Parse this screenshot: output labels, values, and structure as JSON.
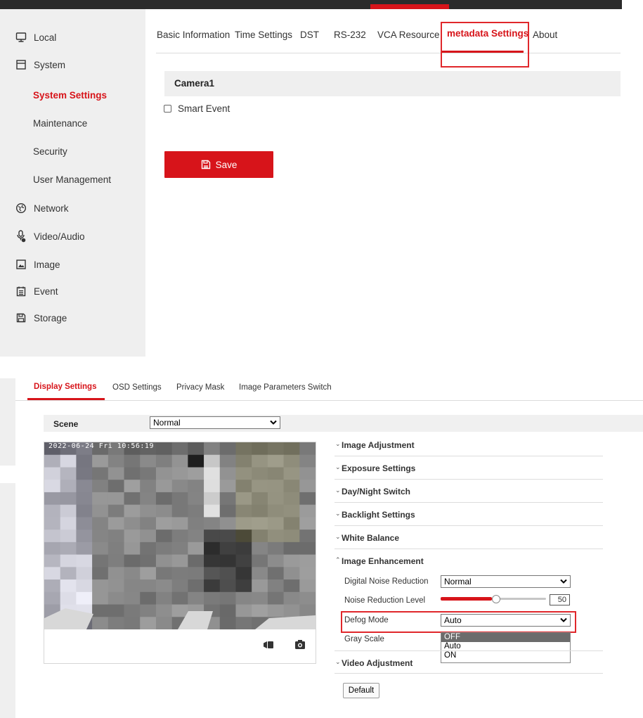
{
  "colors": {
    "accent": "#d7141a",
    "topbar": "#2b2b2b",
    "sidebar_bg": "#efefef"
  },
  "sidebar": {
    "items": [
      {
        "label": "Local",
        "icon": "monitor-icon"
      },
      {
        "label": "System",
        "icon": "window-icon"
      },
      {
        "label": "System Settings",
        "sub": true,
        "active": true
      },
      {
        "label": "Maintenance",
        "sub": true
      },
      {
        "label": "Security",
        "sub": true
      },
      {
        "label": "User Management",
        "sub": true
      },
      {
        "label": "Network",
        "icon": "globe-icon"
      },
      {
        "label": "Video/Audio",
        "icon": "microphone-icon"
      },
      {
        "label": "Image",
        "icon": "image-icon"
      },
      {
        "label": "Event",
        "icon": "calendar-icon"
      },
      {
        "label": "Storage",
        "icon": "floppy-disk-icon"
      }
    ]
  },
  "tabs": {
    "items": [
      "Basic Information",
      "Time Settings",
      "DST",
      "RS-232",
      "VCA Resource",
      "metadata Settings",
      "About"
    ],
    "active": "metadata Settings"
  },
  "metadata": {
    "camera_label": "Camera1",
    "smart_event_label": "Smart Event",
    "smart_event_checked": false,
    "save_label": "Save"
  },
  "image_tabs": {
    "items": [
      "Display Settings",
      "OSD Settings",
      "Privacy Mask",
      "Image Parameters Switch"
    ],
    "active": "Display Settings"
  },
  "scene": {
    "label": "Scene",
    "value": "Normal"
  },
  "preview": {
    "osd_time": "2022-06-24 Fri 10:56:19",
    "record_icon": "record-clip-icon",
    "snapshot_icon": "camera-snapshot-icon"
  },
  "sections": {
    "image_adjustment": "Image Adjustment",
    "exposure": "Exposure Settings",
    "day_night": "Day/Night Switch",
    "backlight": "Backlight Settings",
    "white_balance": "White Balance",
    "image_enhancement": "Image Enhancement",
    "video_adjustment": "Video Adjustment"
  },
  "enhancement": {
    "dnr_label": "Digital Noise Reduction",
    "dnr_value": "Normal",
    "nr_level_label": "Noise Reduction Level",
    "nr_level_value": "50",
    "defog_label": "Defog Mode",
    "defog_value": "Auto",
    "defog_options": [
      "OFF",
      "Auto",
      "ON"
    ],
    "gray_scale_label": "Gray Scale"
  },
  "default_label": "Default"
}
